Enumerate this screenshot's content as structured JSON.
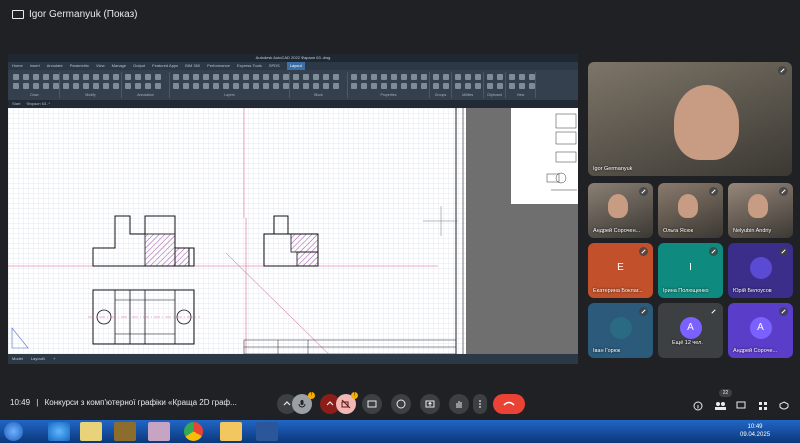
{
  "meeting": {
    "presenter_label": "Igor Germanyuk (Показ)",
    "time": "10:49",
    "separator": "|",
    "title": "Конкурси з комп'ютерної графіки «Краща 2D граф...",
    "badge_mic": "!",
    "badge_cam": "!",
    "people_count": "22"
  },
  "cad": {
    "window_title": "Autodesk AutoCAD 2022   Фараон 63..dwg",
    "ribbon_tabs": [
      "Home",
      "Insert",
      "Annotate",
      "Parametric",
      "View",
      "Manage",
      "Output",
      "Featured Apps",
      "BIM 360",
      "Performance",
      "Express Tools",
      "SPDS",
      "Layout"
    ],
    "active_tab": "Layout",
    "ribbon_groups": [
      "Draw",
      "Modify",
      "Annotation",
      "Layers",
      "Block",
      "Properties",
      "Groups",
      "Utilities",
      "Clipboard",
      "View"
    ],
    "doc_tabs": [
      "Start",
      "Фараон 63..*"
    ],
    "status_items": [
      "Model",
      "Layout1",
      "+"
    ]
  },
  "participants": [
    {
      "name": "Igor Germanyuk",
      "type": "video",
      "bg": "#7d7568"
    },
    {
      "name": "Андрей Сорочен...",
      "type": "video",
      "bg": "#8a7f74"
    },
    {
      "name": "Ольга Ясюк",
      "type": "video",
      "bg": "#8a7a6c"
    },
    {
      "name": "Nelyubin Andriy",
      "type": "video",
      "bg": "#97877a"
    },
    {
      "name": "Екатерина Боклаг...",
      "type": "avatar",
      "initial": "E",
      "bg": "#c2502b",
      "tile": "#c2502b"
    },
    {
      "name": "Ірина Полющенко",
      "type": "avatar",
      "initial": "І",
      "bg": "#0f8a7e",
      "tile": "#0f8a7e"
    },
    {
      "name": "Юрій Белоусов",
      "type": "avatar",
      "initial": "",
      "bg": "#5b4ad3",
      "tile": "#3a2e8a"
    },
    {
      "name": "Іван Горюк",
      "type": "avatar",
      "initial": "",
      "bg": "#2b6a83",
      "tile": "#2b5a7a"
    },
    {
      "name": "Ещё 12 чел.",
      "type": "more",
      "initial": "A",
      "bg": "#7b61ff",
      "tile": "#3c4043"
    },
    {
      "name": "Андрей Сороче...",
      "type": "avatar",
      "initial": "A",
      "bg": "#7b61ff",
      "tile": "#5a3dc8"
    }
  ],
  "clock": {
    "time": "10:49",
    "date": "09.04.2025"
  },
  "colors": {
    "end_call": "#ea4335",
    "meet_bg": "#202124",
    "cad_dark": "#34404d",
    "hatch": "#8a2c8a",
    "center_line": "#e0607a"
  }
}
